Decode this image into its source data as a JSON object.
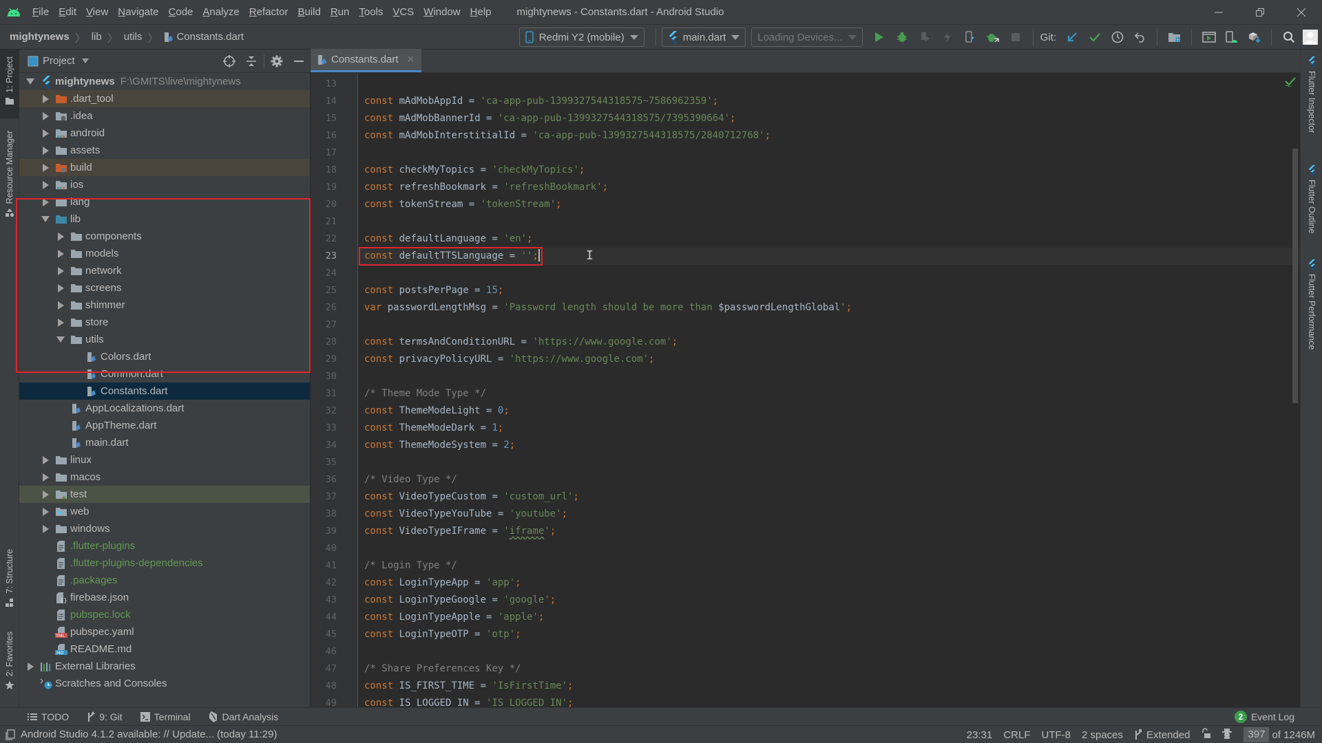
{
  "window": {
    "title": "mightynews - Constants.dart - Android Studio",
    "controls": {
      "minimize": "minimize-icon",
      "restore": "restore-icon",
      "close": "close-icon"
    }
  },
  "menu": [
    "File",
    "Edit",
    "View",
    "Navigate",
    "Code",
    "Analyze",
    "Refactor",
    "Build",
    "Run",
    "Tools",
    "VCS",
    "Window",
    "Help"
  ],
  "breadcrumb": [
    "mightynews",
    "lib",
    "utils",
    "Constants.dart"
  ],
  "toolbar": {
    "device": "Redmi Y2 (mobile)",
    "run_config": "main.dart",
    "device_selector": "Loading Devices...",
    "git_label": "Git:",
    "buttons": [
      "run-icon",
      "debug-icon",
      "attach-debugger-icon",
      "hot-reload-icon",
      "flutter-device-icon",
      "debug-attach-icon",
      "stop-icon",
      "git-update-icon",
      "git-commit-icon",
      "git-history-icon",
      "git-rollback-icon",
      "project-structure-icon",
      "avd-manager-icon",
      "device-manager-icon",
      "sdk-manager-icon",
      "search-icon",
      "user-avatar"
    ]
  },
  "left_stripe": [
    {
      "label": "1: Project",
      "icon": "folder-icon",
      "active": true
    },
    {
      "label": "Resource Manager",
      "icon": "resource-manager-icon",
      "active": false
    },
    {
      "label": "7: Structure",
      "icon": "structure-icon",
      "active": false
    },
    {
      "label": "2: Favorites",
      "icon": "star-icon",
      "active": false
    }
  ],
  "right_stripe": [
    {
      "label": "Flutter Inspector",
      "icon": "flutter-icon"
    },
    {
      "label": "Flutter Outline",
      "icon": "flutter-icon"
    },
    {
      "label": "Flutter Performance",
      "icon": "flutter-icon"
    }
  ],
  "project_panel": {
    "title": "Project",
    "actions": [
      "locate-icon",
      "collapse-all-icon",
      "settings-icon",
      "hide-icon"
    ],
    "tree": [
      {
        "depth": 0,
        "label": "mightynews",
        "hint": "F:\\GMITS\\live\\mightynews",
        "state": "open",
        "icon": "flutter-icon",
        "bold": true
      },
      {
        "depth": 1,
        "label": ".dart_tool",
        "state": "closed",
        "icon": "folder-excluded-icon",
        "style": "excluded"
      },
      {
        "depth": 1,
        "label": ".idea",
        "state": "closed",
        "icon": "folder-config-icon"
      },
      {
        "depth": 1,
        "label": "android",
        "state": "closed",
        "icon": "folder-module-icon"
      },
      {
        "depth": 1,
        "label": "assets",
        "state": "closed",
        "icon": "folder-icon"
      },
      {
        "depth": 1,
        "label": "build",
        "state": "closed",
        "icon": "folder-excluded-config-icon",
        "style": "excluded"
      },
      {
        "depth": 1,
        "label": "ios",
        "state": "closed",
        "icon": "folder-module-icon"
      },
      {
        "depth": 1,
        "label": "lang",
        "state": "closed",
        "icon": "folder-icon"
      },
      {
        "depth": 1,
        "label": "lib",
        "state": "open",
        "icon": "folder-source-icon"
      },
      {
        "depth": 2,
        "label": "components",
        "state": "closed",
        "icon": "folder-icon"
      },
      {
        "depth": 2,
        "label": "models",
        "state": "closed",
        "icon": "folder-icon"
      },
      {
        "depth": 2,
        "label": "network",
        "state": "closed",
        "icon": "folder-icon"
      },
      {
        "depth": 2,
        "label": "screens",
        "state": "closed",
        "icon": "folder-icon"
      },
      {
        "depth": 2,
        "label": "shimmer",
        "state": "closed",
        "icon": "folder-icon"
      },
      {
        "depth": 2,
        "label": "store",
        "state": "closed",
        "icon": "folder-icon"
      },
      {
        "depth": 2,
        "label": "utils",
        "state": "open",
        "icon": "folder-icon"
      },
      {
        "depth": 3,
        "label": "Colors.dart",
        "state": "leaf",
        "icon": "dart-file-icon"
      },
      {
        "depth": 3,
        "label": "Common.dart",
        "state": "leaf",
        "icon": "dart-file-icon"
      },
      {
        "depth": 3,
        "label": "Constants.dart",
        "state": "leaf",
        "icon": "dart-file-icon",
        "style": "selected"
      },
      {
        "depth": 2,
        "label": "AppLocalizations.dart",
        "state": "leaf",
        "icon": "dart-file-icon"
      },
      {
        "depth": 2,
        "label": "AppTheme.dart",
        "state": "leaf",
        "icon": "dart-file-icon"
      },
      {
        "depth": 2,
        "label": "main.dart",
        "state": "leaf",
        "icon": "dart-file-icon"
      },
      {
        "depth": 1,
        "label": "linux",
        "state": "closed",
        "icon": "folder-icon"
      },
      {
        "depth": 1,
        "label": "macos",
        "state": "closed",
        "icon": "folder-icon"
      },
      {
        "depth": 1,
        "label": "test",
        "state": "closed",
        "icon": "folder-test-icon",
        "style": "test-root"
      },
      {
        "depth": 1,
        "label": "web",
        "state": "closed",
        "icon": "folder-web-icon"
      },
      {
        "depth": 1,
        "label": "windows",
        "state": "closed",
        "icon": "folder-icon"
      },
      {
        "depth": 1,
        "label": ".flutter-plugins",
        "state": "leaf",
        "icon": "text-file-icon",
        "vcs": "added"
      },
      {
        "depth": 1,
        "label": ".flutter-plugins-dependencies",
        "state": "leaf",
        "icon": "text-file-icon",
        "vcs": "added"
      },
      {
        "depth": 1,
        "label": ".packages",
        "state": "leaf",
        "icon": "text-file-icon",
        "vcs": "added"
      },
      {
        "depth": 1,
        "label": "firebase.json",
        "state": "leaf",
        "icon": "json-file-icon"
      },
      {
        "depth": 1,
        "label": "pubspec.lock",
        "state": "leaf",
        "icon": "text-file-icon",
        "vcs": "added"
      },
      {
        "depth": 1,
        "label": "pubspec.yaml",
        "state": "leaf",
        "icon": "yaml-file-icon"
      },
      {
        "depth": 1,
        "label": "README.md",
        "state": "leaf",
        "icon": "markdown-file-icon"
      },
      {
        "depth": 0,
        "label": "External Libraries",
        "state": "closed",
        "icon": "libraries-icon"
      },
      {
        "depth": 0,
        "label": "Scratches and Consoles",
        "state": "leaf-root",
        "icon": "scratches-icon"
      }
    ]
  },
  "editor": {
    "tab": {
      "label": "Constants.dart",
      "icon": "dart-file-icon",
      "close": "close-icon"
    },
    "current_line": 23,
    "lines": [
      {
        "n": 13,
        "tokens": []
      },
      {
        "n": 14,
        "tokens": [
          [
            "kw",
            "const"
          ],
          [
            "id",
            " mAdMobAppId = "
          ],
          [
            "str",
            "'ca-app-pub-1399327544318575~7586962359'"
          ],
          [
            "punc",
            ";"
          ]
        ]
      },
      {
        "n": 15,
        "tokens": [
          [
            "kw",
            "const"
          ],
          [
            "id",
            " mAdMobBannerId = "
          ],
          [
            "str",
            "'ca-app-pub-1399327544318575/7395390664'"
          ],
          [
            "punc",
            ";"
          ]
        ]
      },
      {
        "n": 16,
        "tokens": [
          [
            "kw",
            "const"
          ],
          [
            "id",
            " mAdMobInterstitialId = "
          ],
          [
            "str",
            "'ca-app-pub-1399327544318575/2840712768'"
          ],
          [
            "punc",
            ";"
          ]
        ]
      },
      {
        "n": 17,
        "tokens": []
      },
      {
        "n": 18,
        "tokens": [
          [
            "kw",
            "const"
          ],
          [
            "id",
            " checkMyTopics = "
          ],
          [
            "str",
            "'checkMyTopics'"
          ],
          [
            "punc",
            ";"
          ]
        ]
      },
      {
        "n": 19,
        "tokens": [
          [
            "kw",
            "const"
          ],
          [
            "id",
            " refreshBookmark = "
          ],
          [
            "str",
            "'refreshBookmark'"
          ],
          [
            "punc",
            ";"
          ]
        ]
      },
      {
        "n": 20,
        "tokens": [
          [
            "kw",
            "const"
          ],
          [
            "id",
            " tokenStream = "
          ],
          [
            "str",
            "'tokenStream'"
          ],
          [
            "punc",
            ";"
          ]
        ]
      },
      {
        "n": 21,
        "tokens": []
      },
      {
        "n": 22,
        "tokens": [
          [
            "kw",
            "const"
          ],
          [
            "id",
            " defaultLanguage = "
          ],
          [
            "str",
            "'en'"
          ],
          [
            "punc",
            ";"
          ]
        ]
      },
      {
        "n": 23,
        "tokens": [
          [
            "kw",
            "const"
          ],
          [
            "id",
            " defaultTTSLanguage = "
          ],
          [
            "str",
            "''"
          ],
          [
            "punc",
            ";"
          ]
        ],
        "caret": true,
        "highlight_box": true
      },
      {
        "n": 24,
        "tokens": []
      },
      {
        "n": 25,
        "tokens": [
          [
            "kw",
            "const"
          ],
          [
            "id",
            " postsPerPage = "
          ],
          [
            "num",
            "15"
          ],
          [
            "punc",
            ";"
          ]
        ]
      },
      {
        "n": 26,
        "tokens": [
          [
            "kw",
            "var"
          ],
          [
            "id",
            " passwordLengthMsg = "
          ],
          [
            "str",
            "'Password length should be more than "
          ],
          [
            "id",
            "$passwordLengthGlobal"
          ],
          [
            "str",
            "'"
          ],
          [
            "punc",
            ";"
          ]
        ]
      },
      {
        "n": 27,
        "tokens": []
      },
      {
        "n": 28,
        "tokens": [
          [
            "kw",
            "const"
          ],
          [
            "id",
            " termsAndConditionURL = "
          ],
          [
            "str",
            "'https://www.google.com'"
          ],
          [
            "punc",
            ";"
          ]
        ]
      },
      {
        "n": 29,
        "tokens": [
          [
            "kw",
            "const"
          ],
          [
            "id",
            " privacyPolicyURL = "
          ],
          [
            "str",
            "'https://www.google.com'"
          ],
          [
            "punc",
            ";"
          ]
        ]
      },
      {
        "n": 30,
        "tokens": []
      },
      {
        "n": 31,
        "tokens": [
          [
            "cm",
            "/* Theme Mode Type */"
          ]
        ]
      },
      {
        "n": 32,
        "tokens": [
          [
            "kw",
            "const"
          ],
          [
            "id",
            " ThemeModeLight = "
          ],
          [
            "num",
            "0"
          ],
          [
            "punc",
            ";"
          ]
        ]
      },
      {
        "n": 33,
        "tokens": [
          [
            "kw",
            "const"
          ],
          [
            "id",
            " ThemeModeDark = "
          ],
          [
            "num",
            "1"
          ],
          [
            "punc",
            ";"
          ]
        ]
      },
      {
        "n": 34,
        "tokens": [
          [
            "kw",
            "const"
          ],
          [
            "id",
            " ThemeModeSystem = "
          ],
          [
            "num",
            "2"
          ],
          [
            "punc",
            ";"
          ]
        ]
      },
      {
        "n": 35,
        "tokens": []
      },
      {
        "n": 36,
        "tokens": [
          [
            "cm",
            "/* Video Type */"
          ]
        ]
      },
      {
        "n": 37,
        "tokens": [
          [
            "kw",
            "const"
          ],
          [
            "id",
            " VideoTypeCustom = "
          ],
          [
            "str",
            "'custom_url'"
          ],
          [
            "punc",
            ";"
          ]
        ]
      },
      {
        "n": 38,
        "tokens": [
          [
            "kw",
            "const"
          ],
          [
            "id",
            " VideoTypeYouTube = "
          ],
          [
            "str",
            "'youtube'"
          ],
          [
            "punc",
            ";"
          ]
        ]
      },
      {
        "n": 39,
        "tokens": [
          [
            "kw",
            "const"
          ],
          [
            "id",
            " VideoTypeIFrame = "
          ],
          [
            "str",
            "'"
          ],
          [
            "typo",
            "iframe"
          ],
          [
            "str",
            "'"
          ],
          [
            "punc",
            ";"
          ]
        ]
      },
      {
        "n": 40,
        "tokens": []
      },
      {
        "n": 41,
        "tokens": [
          [
            "cm",
            "/* Login Type */"
          ]
        ]
      },
      {
        "n": 42,
        "tokens": [
          [
            "kw",
            "const"
          ],
          [
            "id",
            " LoginTypeApp = "
          ],
          [
            "str",
            "'app'"
          ],
          [
            "punc",
            ";"
          ]
        ]
      },
      {
        "n": 43,
        "tokens": [
          [
            "kw",
            "const"
          ],
          [
            "id",
            " LoginTypeGoogle = "
          ],
          [
            "str",
            "'google'"
          ],
          [
            "punc",
            ";"
          ]
        ]
      },
      {
        "n": 44,
        "tokens": [
          [
            "kw",
            "const"
          ],
          [
            "id",
            " LoginTypeApple = "
          ],
          [
            "str",
            "'apple'"
          ],
          [
            "punc",
            ";"
          ]
        ]
      },
      {
        "n": 45,
        "tokens": [
          [
            "kw",
            "const"
          ],
          [
            "id",
            " LoginTypeOTP = "
          ],
          [
            "str",
            "'otp'"
          ],
          [
            "punc",
            ";"
          ]
        ]
      },
      {
        "n": 46,
        "tokens": []
      },
      {
        "n": 47,
        "tokens": [
          [
            "cm",
            "/* Share Preferences Key */"
          ]
        ]
      },
      {
        "n": 48,
        "tokens": [
          [
            "kw",
            "const"
          ],
          [
            "id",
            " IS_FIRST_TIME = "
          ],
          [
            "str",
            "'IsFirstTime'"
          ],
          [
            "punc",
            ";"
          ]
        ]
      },
      {
        "n": 49,
        "tokens": [
          [
            "kw",
            "const"
          ],
          [
            "id",
            " IS_LOGGED_IN = "
          ],
          [
            "str",
            "'IS_LOGGED_IN'"
          ],
          [
            "punc",
            ";"
          ]
        ]
      }
    ]
  },
  "bottom_tabs": [
    {
      "label": "TODO",
      "icon": "todo-list-icon"
    },
    {
      "label": "9: Git",
      "icon": "git-branch-icon"
    },
    {
      "label": "Terminal",
      "icon": "terminal-icon"
    },
    {
      "label": "Dart Analysis",
      "icon": "dart-analysis-icon"
    }
  ],
  "event_log": {
    "label": "Event Log",
    "count": "2"
  },
  "status": {
    "message": "Android Studio 4.1.2 available: // Update... (today 11:29)",
    "position": "23:31",
    "line_separator": "CRLF",
    "encoding": "UTF-8",
    "indent": "2 spaces",
    "git_branch": "Extended",
    "memory_used": "397",
    "memory_total": "of 1246M"
  }
}
